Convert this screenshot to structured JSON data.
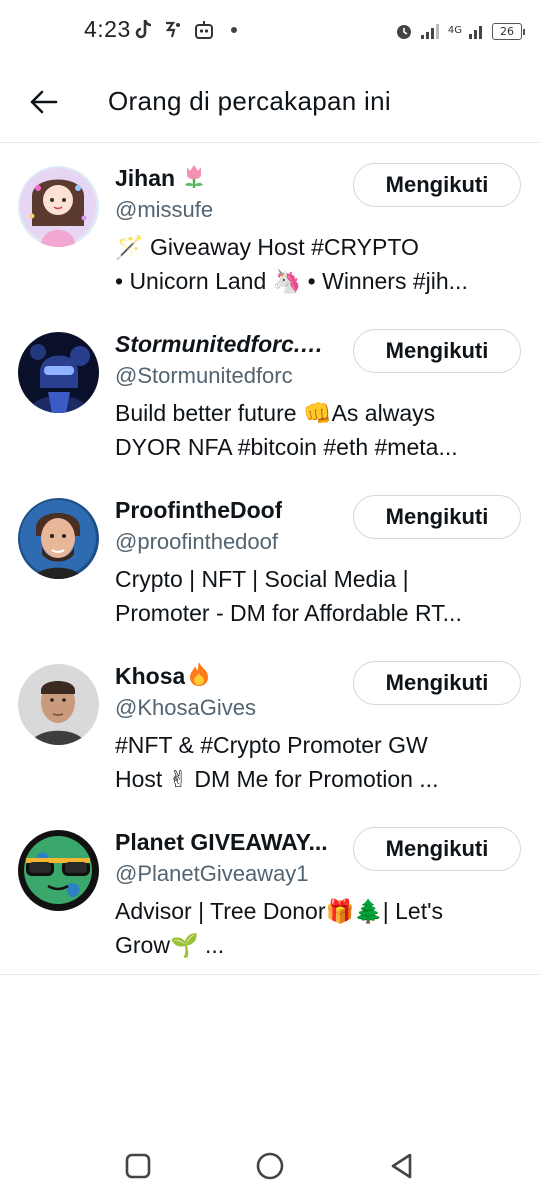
{
  "status_bar": {
    "time": "4:23",
    "network_label": "4G",
    "battery": "26"
  },
  "header": {
    "title": "Orang di percakapan ini"
  },
  "people": [
    {
      "name": "Jihan",
      "name_emoji": "tulip",
      "handle": "@missufe",
      "bio_line1": "🪄 Giveaway Host #CRYPTO",
      "bio_line2": "• Unicorn Land 🦄 • Winners #jih...",
      "button": "Mengikuti"
    },
    {
      "name": "Stormunitedforc.…",
      "handle": "@Stormunitedforc",
      "bio_line1": "Build better future 👊As always",
      "bio_line2": "DYOR NFA  #bitcoin #eth #meta...",
      "button": "Mengikuti"
    },
    {
      "name": "ProofintheDoof",
      "handle": "@proofinthedoof",
      "bio_line1": "Crypto | NFT | Social Media |",
      "bio_line2": "Promoter - DM for Affordable RT...",
      "button": "Mengikuti"
    },
    {
      "name": "Khosa",
      "name_emoji": "fire",
      "handle": "@KhosaGives",
      "bio_line1": "#NFT & #Crypto Promoter GW",
      "bio_line2": "Host ✌ DM Me for Promotion ...",
      "button": "Mengikuti"
    },
    {
      "name": "Planet GIVEAWAY...",
      "handle": "@PlanetGiveaway1",
      "bio_line1": "Advisor | Tree Donor🎁🌲|  Let's",
      "bio_line2": "Grow🌱  ...",
      "button": "Mengikuti"
    }
  ],
  "colors": {
    "text_primary": "#0f1419",
    "text_secondary": "#536471",
    "border": "#cfd9de",
    "divider": "#e4e7e9"
  },
  "nav": {
    "recent_icon": "square-icon",
    "home_icon": "circle-icon",
    "back_icon": "triangle-back-icon"
  }
}
